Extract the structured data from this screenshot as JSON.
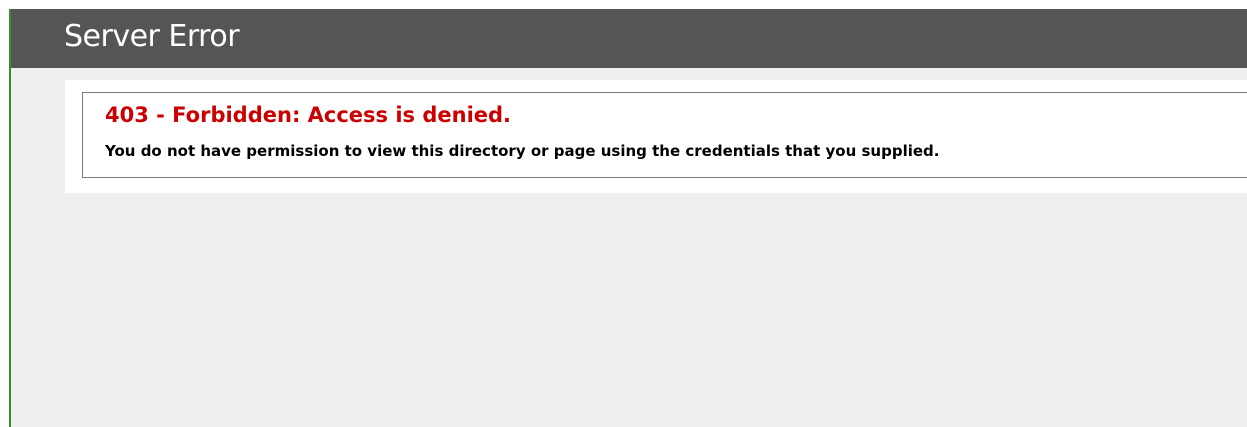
{
  "header": {
    "title": "Server Error"
  },
  "error": {
    "heading": "403 - Forbidden: Access is denied.",
    "message": "You do not have permission to view this directory or page using the credentials that you supplied."
  },
  "colors": {
    "header_background": "#555555",
    "page_background": "#eeeeee",
    "heading_color": "#cc0000",
    "left_border_accent": "#3a8a32"
  }
}
